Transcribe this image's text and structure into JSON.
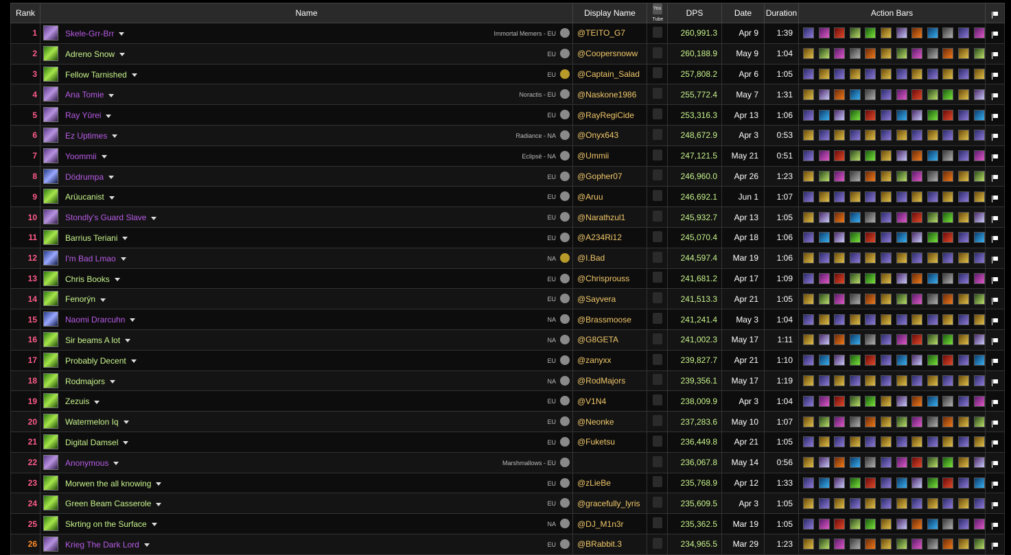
{
  "headers": {
    "rank": "Rank",
    "name": "Name",
    "display_name": "Display Name",
    "youtube": "You Tube",
    "dps": "DPS",
    "date": "Date",
    "duration": "Duration",
    "action_bars": "Action Bars"
  },
  "colors": {
    "rank_pink": "#ff5b8a",
    "rank_orange": "#ff8a2a",
    "name_purple": "#b75be6",
    "name_green": "#c8f48c",
    "display_name": "#f2c86a"
  },
  "rows": [
    {
      "rank": "1",
      "name": "Skele-Grr-Brr",
      "realm": "Immortal Memers - EU",
      "display": "@TEITO_G7",
      "dps": "260,991.3",
      "date": "Apr 9",
      "duration": "1:39"
    },
    {
      "rank": "2",
      "name": "Adreno Snow",
      "realm": "EU",
      "display": "@Coopersnoww",
      "dps": "260,188.9",
      "date": "May 9",
      "duration": "1:04"
    },
    {
      "rank": "3",
      "name": "Fellow Tarnished",
      "realm": "EU",
      "display": "@Captain_Salad",
      "dps": "257,808.2",
      "date": "Apr 6",
      "duration": "1:05"
    },
    {
      "rank": "4",
      "name": "Ana Tomie",
      "realm": "Noractis - EU",
      "display": "@Naskone1986",
      "dps": "255,772.4",
      "date": "May 7",
      "duration": "1:31"
    },
    {
      "rank": "5",
      "name": "Ray Yūrei",
      "realm": "EU",
      "display": "@RayRegiCide",
      "dps": "253,316.3",
      "date": "Apr 13",
      "duration": "1:06"
    },
    {
      "rank": "6",
      "name": "Ez Uptimes",
      "realm": "Radiance - NA",
      "display": "@Onyx643",
      "dps": "248,672.9",
      "date": "Apr 3",
      "duration": "0:53"
    },
    {
      "rank": "7",
      "name": "Yoommii",
      "realm": "Eclipsë - NA",
      "display": "@Ummii",
      "dps": "247,121.5",
      "date": "May 21",
      "duration": "0:51"
    },
    {
      "rank": "8",
      "name": "Dödrumpa",
      "realm": "EU",
      "display": "@Gopher07",
      "dps": "246,960.0",
      "date": "Apr 26",
      "duration": "1:23"
    },
    {
      "rank": "9",
      "name": "Arüucanist",
      "realm": "EU",
      "display": "@Aruu",
      "dps": "246,692.1",
      "date": "Jun 1",
      "duration": "1:07"
    },
    {
      "rank": "10",
      "name": "Stondly's Guard Slave",
      "realm": "EU",
      "display": "@Narathzul1",
      "dps": "245,932.7",
      "date": "Apr 13",
      "duration": "1:05"
    },
    {
      "rank": "11",
      "name": "Barrius Teriani",
      "realm": "EU",
      "display": "@A234Ri12",
      "dps": "245,070.4",
      "date": "Apr 18",
      "duration": "1:06"
    },
    {
      "rank": "12",
      "name": "I'm Bad Lmao",
      "realm": "NA",
      "display": "@I.Bad",
      "dps": "244,597.4",
      "date": "Mar 19",
      "duration": "1:06"
    },
    {
      "rank": "13",
      "name": "Chris Books",
      "realm": "EU",
      "display": "@Chrisprouss",
      "dps": "241,681.2",
      "date": "Apr 17",
      "duration": "1:09"
    },
    {
      "rank": "14",
      "name": "Fenorýn",
      "realm": "EU",
      "display": "@Sayvera",
      "dps": "241,513.3",
      "date": "Apr 21",
      "duration": "1:05"
    },
    {
      "rank": "15",
      "name": "Naomi Drarcuhn",
      "realm": "NA",
      "display": "@Brassmoose",
      "dps": "241,241.4",
      "date": "May 3",
      "duration": "1:04"
    },
    {
      "rank": "16",
      "name": "Sir beams A lot",
      "realm": "NA",
      "display": "@G8GETA",
      "dps": "241,002.3",
      "date": "May 17",
      "duration": "1:11"
    },
    {
      "rank": "17",
      "name": "Probably Decent",
      "realm": "EU",
      "display": "@zanyxx",
      "dps": "239,827.7",
      "date": "Apr 21",
      "duration": "1:10"
    },
    {
      "rank": "18",
      "name": "Rodmajors",
      "realm": "NA",
      "display": "@RodMajors",
      "dps": "239,356.1",
      "date": "May 17",
      "duration": "1:19"
    },
    {
      "rank": "19",
      "name": "Zezuis",
      "realm": "EU",
      "display": "@V1N4",
      "dps": "238,009.9",
      "date": "Apr 3",
      "duration": "1:04"
    },
    {
      "rank": "20",
      "name": "Watermelon Iq",
      "realm": "EU",
      "display": "@Neonke",
      "dps": "237,283.6",
      "date": "May 10",
      "duration": "1:07"
    },
    {
      "rank": "21",
      "name": "Digital Damsel",
      "realm": "EU",
      "display": "@Fuketsu",
      "dps": "236,449.8",
      "date": "Apr 21",
      "duration": "1:05"
    },
    {
      "rank": "22",
      "name": "Anonymous",
      "realm": "Marshmallows - EU",
      "display": "",
      "dps": "236,067.8",
      "date": "May 14",
      "duration": "0:56"
    },
    {
      "rank": "23",
      "name": "Morwen the all knowing",
      "realm": "EU",
      "display": "@zLieBe",
      "dps": "235,768.9",
      "date": "Apr 12",
      "duration": "1:33"
    },
    {
      "rank": "24",
      "name": "Green Beam Casserole",
      "realm": "EU",
      "display": "@gracefully_lyris",
      "dps": "235,609.5",
      "date": "Apr 3",
      "duration": "1:05"
    },
    {
      "rank": "25",
      "name": "Skrting on the Surface",
      "realm": "NA",
      "display": "@DJ_M1n3r",
      "dps": "235,362.5",
      "date": "Mar 19",
      "duration": "1:05"
    },
    {
      "rank": "26",
      "name": "Krieg The Dark Lord",
      "realm": "EU",
      "display": "@BRabbit.3",
      "dps": "234,965.5",
      "date": "Mar 29",
      "duration": "1:23"
    }
  ]
}
